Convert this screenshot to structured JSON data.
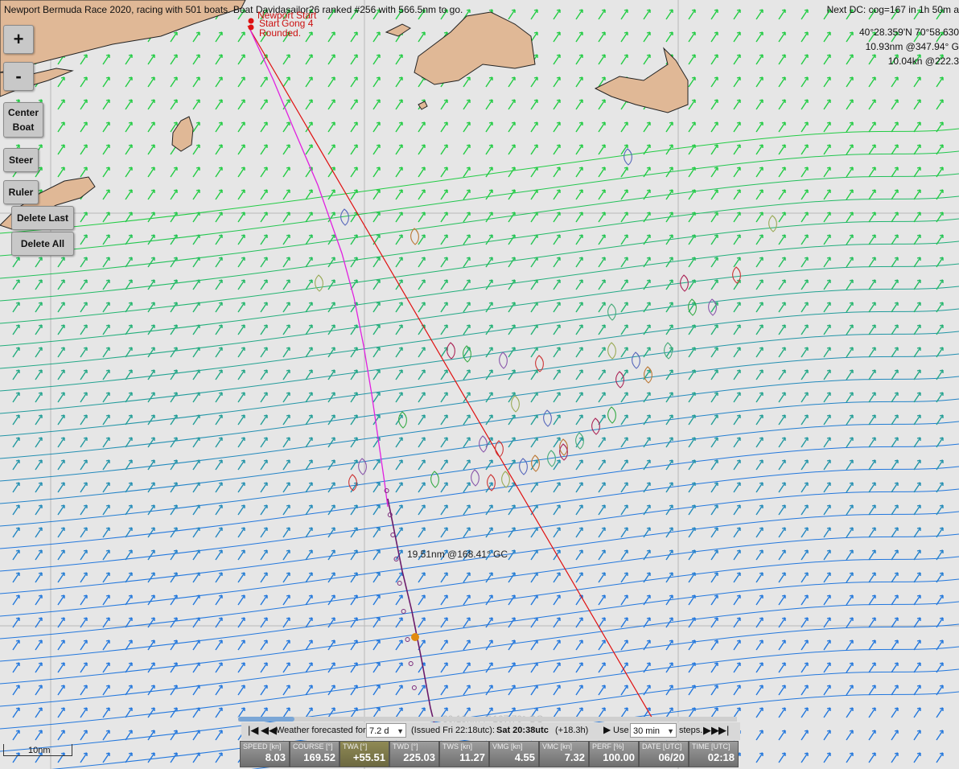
{
  "header": {
    "race_info": "Newport Bermuda Race 2020, racing with 501 boats. Boat Davidasailor26 ranked #256 with 566.5nm to go.",
    "next_dc": "Next DC: cog=167 in 1h 50m a",
    "position": "40°28.359'N 70°58.630",
    "dist1": "10.93nm @347.94° G",
    "dist2": "10.04kn @222.3"
  },
  "controls": {
    "zoom_in": "+",
    "zoom_out": "-",
    "center_boat": "Center Boat",
    "steer": "Steer",
    "ruler": "Ruler",
    "delete_last": "Delete Last",
    "delete_all": "Delete All"
  },
  "map_labels": {
    "newport_start": "Newport Start",
    "start": "Start",
    "gong": "Gong 4",
    "rounded": "Rounded.",
    "ruler_distance": "19.51nm @168.41° GC",
    "ruler_distance_faded": "30.19nm @167.70° GC",
    "scale": "10nm"
  },
  "weather_bar": {
    "label": "Weather forecasted for",
    "forecast_value": "7.2 d",
    "issued": "(Issued Fri 22:18utc):",
    "time": "Sat 20:38utc",
    "offset": "(+18.3h)",
    "use_label": "Use",
    "step_value": "30 min",
    "steps_label": "steps."
  },
  "instruments": [
    {
      "label": "SPEED [kn]",
      "value": "8.03"
    },
    {
      "label": "COURSE [°]",
      "value": "169.52"
    },
    {
      "label": "TWA [°]",
      "value": "+55.51"
    },
    {
      "label": "TWD [°]",
      "value": "225.03"
    },
    {
      "label": "TWS [kn]",
      "value": "11.27"
    },
    {
      "label": "VMG [kn]",
      "value": "4.55"
    },
    {
      "label": "VMC [kn]",
      "value": "7.32"
    },
    {
      "label": "PERF [%]",
      "value": "100.00"
    },
    {
      "label": "DATE [UTC]",
      "value": "06/20"
    },
    {
      "label": "TIME [UTC]",
      "value": "02:18"
    }
  ],
  "colors": {
    "land": "#e0b896",
    "sea": "#e6e6e6",
    "course_line": "#e01010",
    "track": "#e020e0",
    "wind_green": "#22cc44",
    "wind_blue": "#2277dd"
  },
  "icons": {
    "first": "skip-first-icon",
    "rewind": "rewind-icon",
    "play": "play-icon",
    "fast_forward": "fast-forward-icon",
    "last": "skip-last-icon"
  }
}
